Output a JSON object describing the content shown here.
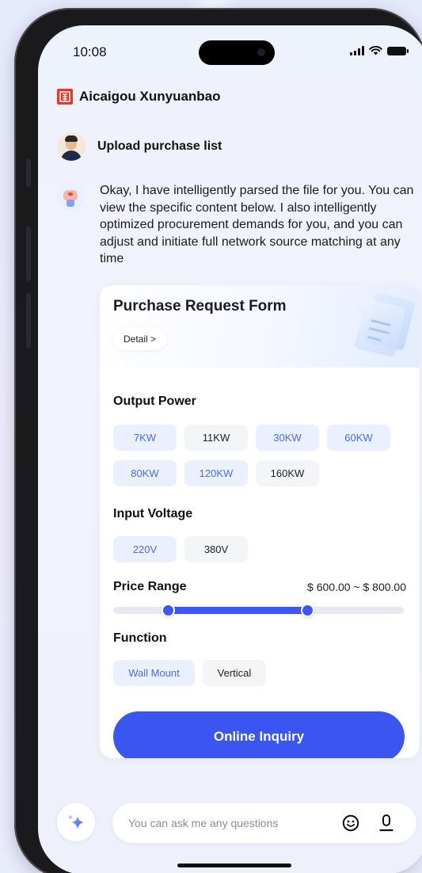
{
  "status_bar": {
    "time": "10:08"
  },
  "app": {
    "title": "Aicaigou Xunyuanbao",
    "logo_glyph": "囧"
  },
  "chat": {
    "user_message": "Upload purchase list",
    "bot_message": "Okay, I have intelligently parsed the file for you. You can view the specific content below. I also intelligently optimized procurement demands for you, and you can adjust and initiate full network source matching at any time"
  },
  "form": {
    "title": "Purchase Request Form",
    "detail_label": "Detail >",
    "output_power": {
      "label": "Output Power",
      "options": [
        {
          "label": "7KW",
          "selected": true
        },
        {
          "label": "11KW",
          "selected": false
        },
        {
          "label": "30KW",
          "selected": true
        },
        {
          "label": "60KW",
          "selected": true
        },
        {
          "label": "80KW",
          "selected": true
        },
        {
          "label": "120KW",
          "selected": true
        },
        {
          "label": "160KW",
          "selected": false
        }
      ]
    },
    "input_voltage": {
      "label": "Input Voltage",
      "options": [
        {
          "label": "220V",
          "selected": true
        },
        {
          "label": "380V",
          "selected": false
        }
      ]
    },
    "price_range": {
      "label": "Price Range",
      "value_text": "$ 600.00 ~ $ 800.00",
      "low_fraction": 0.19,
      "high_fraction": 0.67
    },
    "function": {
      "label": "Function",
      "options": [
        {
          "label": "Wall Mount",
          "selected": true
        },
        {
          "label": "Vertical",
          "selected": false
        }
      ]
    },
    "inquiry_button": "Online Inquiry"
  },
  "input": {
    "placeholder": "You can ask me any questions"
  },
  "colors": {
    "accent": "#3b56f0",
    "chip_selected_bg": "#eaf0fd",
    "chip_selected_text": "#4a6de6"
  }
}
